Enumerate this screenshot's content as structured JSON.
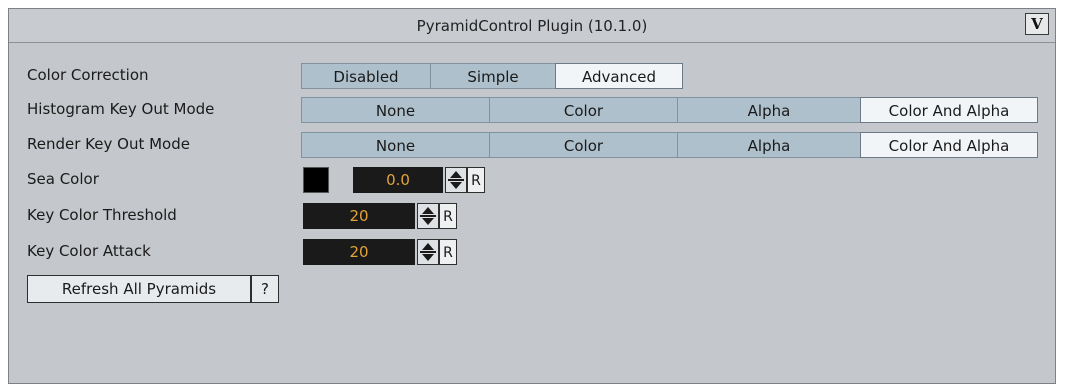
{
  "window": {
    "title": "PyramidControl Plugin (10.1.0)",
    "icon": "viz-logo-icon"
  },
  "color_correction": {
    "label": "Color Correction",
    "options": [
      "Disabled",
      "Simple",
      "Advanced"
    ],
    "selected": "Advanced"
  },
  "histogram_key_out_mode": {
    "label": "Histogram Key Out Mode",
    "options": [
      "None",
      "Color",
      "Alpha",
      "Color And Alpha"
    ],
    "selected": "Color And Alpha"
  },
  "render_key_out_mode": {
    "label": "Render Key Out Mode",
    "options": [
      "None",
      "Color",
      "Alpha",
      "Color And Alpha"
    ],
    "selected": "Color And Alpha"
  },
  "sea_color": {
    "label": "Sea Color",
    "swatch_color": "#000000",
    "value": "0.0",
    "reset_label": "R"
  },
  "key_color_threshold": {
    "label": "Key Color Threshold",
    "value": "20",
    "reset_label": "R"
  },
  "key_color_attack": {
    "label": "Key Color Attack",
    "value": "20",
    "reset_label": "R"
  },
  "refresh": {
    "label": "Refresh All Pyramids",
    "help_label": "?"
  },
  "colors": {
    "panel_bg": "#c4c8cc",
    "segment_bg": "#aec0cc",
    "segment_active_bg": "#f2f5f8",
    "number_field_bg": "#1a1a1a",
    "number_text": "#e3a338"
  }
}
